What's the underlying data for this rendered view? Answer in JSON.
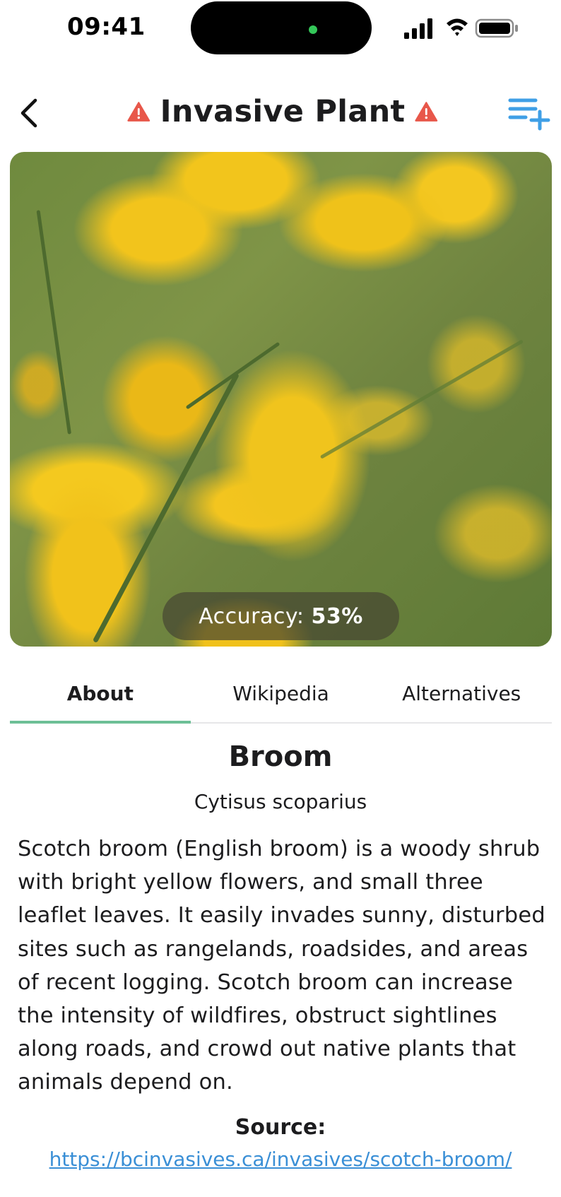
{
  "status_bar": {
    "time": "09:41"
  },
  "nav": {
    "title": "Invasive Plant"
  },
  "photo": {
    "accuracy_label": "Accuracy:",
    "accuracy_value": "53%"
  },
  "tabs": [
    {
      "label": "About",
      "active": true
    },
    {
      "label": "Wikipedia",
      "active": false
    },
    {
      "label": "Alternatives",
      "active": false
    }
  ],
  "about": {
    "common_name": "Broom",
    "scientific_name": "Cytisus scoparius",
    "description": "Scotch broom (English broom) is a woody shrub with bright yellow flowers, and small three leaflet leaves. It easily invades sunny, disturbed sites such as rangelands, roadsides, and areas of recent logging. Scotch broom can increase the intensity of wildfires, obstruct sightlines along roads, and crowd out native plants that animals depend on.",
    "source_label": "Source:",
    "source_url": "https://bcinvasives.ca/invasives/scotch-broom/"
  },
  "colors": {
    "warning": "#e8574a",
    "accent_blue": "#3f9fe6",
    "tab_indicator": "#6dbf96",
    "link": "#3a8fd6"
  },
  "icons": {
    "back": "chevron-left-icon",
    "warning": "warning-triangle-icon",
    "add_to_list": "playlist-add-icon"
  }
}
